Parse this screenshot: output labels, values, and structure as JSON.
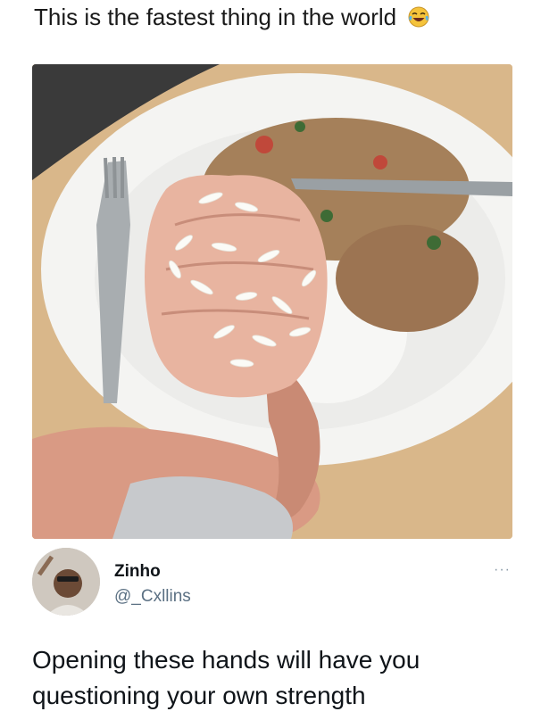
{
  "caption": {
    "text": "This is the fastest thing in the world",
    "emoji": "laughing-crying-emoji"
  },
  "photo": {
    "subject": "baby-fist-holding-rice-over-plate"
  },
  "tweet": {
    "author_name": "Zinho",
    "author_handle": "@_Cxllins",
    "more_label": "···",
    "text": "Opening these hands will have you questioning your own strength"
  },
  "colors": {
    "text": "#0f1419",
    "handle": "#5b7083",
    "table": "#d9b78a",
    "plate": "#f4f4f2"
  }
}
